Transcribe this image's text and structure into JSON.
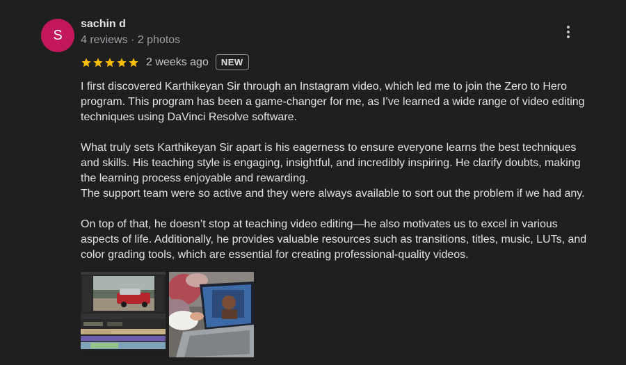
{
  "reviewer": {
    "initial": "S",
    "name": "sachin d",
    "meta": "4 reviews · 2 photos",
    "avatar_color": "#c2185b"
  },
  "rating": {
    "stars": 5,
    "max_stars": 5,
    "star_color": "#fbbc04",
    "time": "2 weeks ago",
    "badge": "NEW"
  },
  "review": {
    "paragraphs": [
      {
        "lines": [
          "I first discovered Karthikeyan Sir through an Instagram video, which led me to join the Zero to Hero",
          "program. This program has been a game-changer for me, as I’ve learned a wide range of video editing",
          "techniques using DaVinci Resolve software."
        ]
      },
      {
        "lines": [
          "What truly sets Karthikeyan Sir apart is his eagerness to ensure everyone learns the best techniques",
          "and skills. His teaching style is engaging, insightful, and incredibly inspiring. He clarify doubts, making",
          "the learning process enjoyable and rewarding.",
          "The support team were so active and they were always available to sort out the problem if we had any."
        ]
      },
      {
        "lines": [
          "On top of that, he doesn’t stop at teaching video editing—he also motivates us to excel in various",
          "aspects of life. Additionally, he provides valuable resources such as transitions, titles, music, LUTs, and",
          "color grading tools, which are essential for creating professional-quality videos."
        ]
      }
    ]
  },
  "icons": {
    "more": "more-vert-icon",
    "star": "star-icon"
  },
  "photos": [
    "davinci-resolve-editor-screenshot",
    "laptop-video-call-photo"
  ],
  "colors": {
    "background": "#1f1f1f",
    "text": "#e3e3e3",
    "secondary_text": "#9aa0a6"
  }
}
